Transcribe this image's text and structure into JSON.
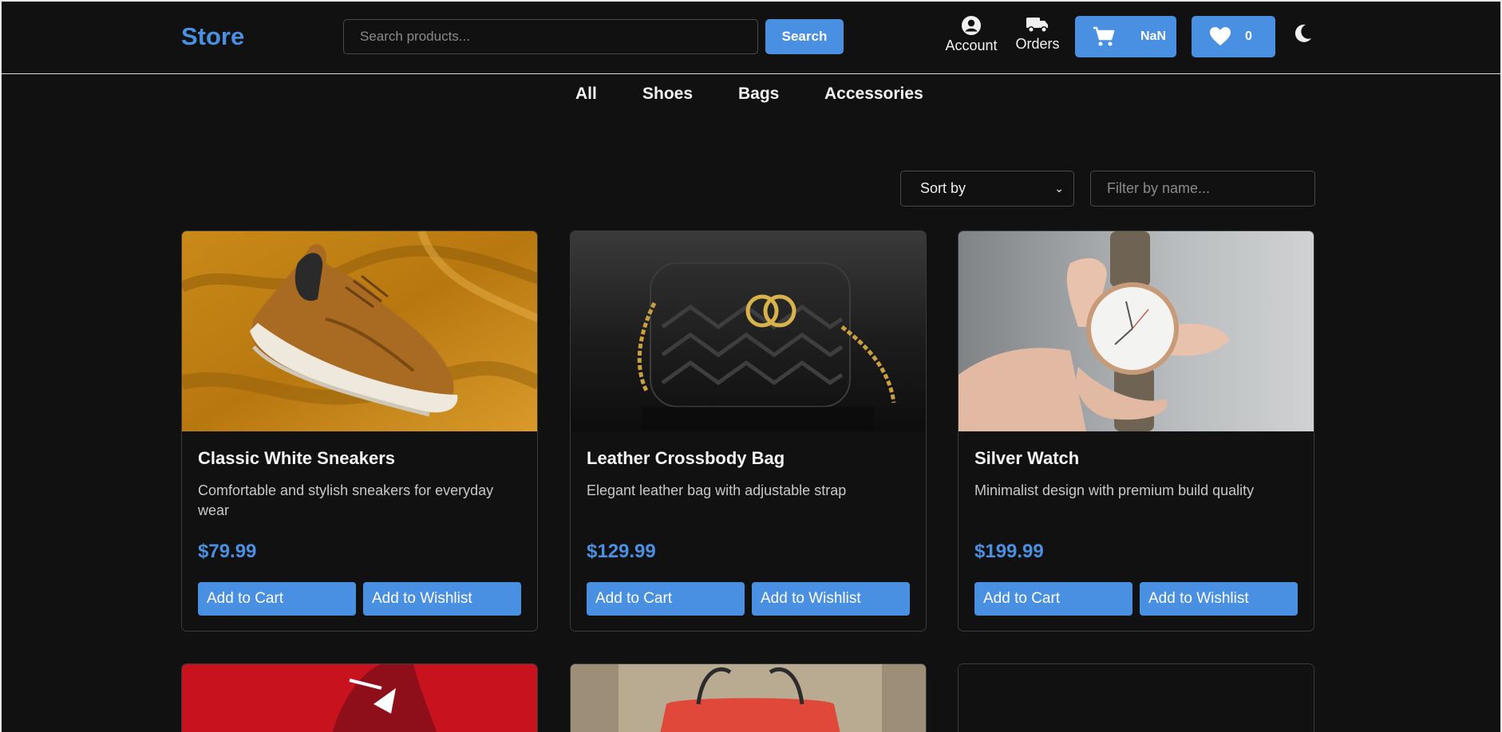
{
  "header": {
    "logo": "Store",
    "search_placeholder": "Search products...",
    "search_button": "Search",
    "account_label": "Account",
    "orders_label": "Orders",
    "cart_count": "NaN",
    "wishlist_count": "0"
  },
  "categories": [
    "All",
    "Shoes",
    "Bags",
    "Accessories"
  ],
  "toolbar": {
    "sort_label": "Sort by",
    "filter_placeholder": "Filter by name..."
  },
  "products": [
    {
      "name": "Classic White Sneakers",
      "description": "Comfortable and stylish sneakers for everyday wear",
      "price": "$79.99",
      "add_to_cart": "Add to Cart",
      "add_to_wishlist": "Add to Wishlist"
    },
    {
      "name": "Leather Crossbody Bag",
      "description": "Elegant leather bag with adjustable strap",
      "price": "$129.99",
      "add_to_cart": "Add to Cart",
      "add_to_wishlist": "Add to Wishlist"
    },
    {
      "name": "Silver Watch",
      "description": "Minimalist design with premium build quality",
      "price": "$199.99",
      "add_to_cart": "Add to Cart",
      "add_to_wishlist": "Add to Wishlist"
    }
  ],
  "colors": {
    "accent": "#4a90e2",
    "background": "#111111"
  }
}
